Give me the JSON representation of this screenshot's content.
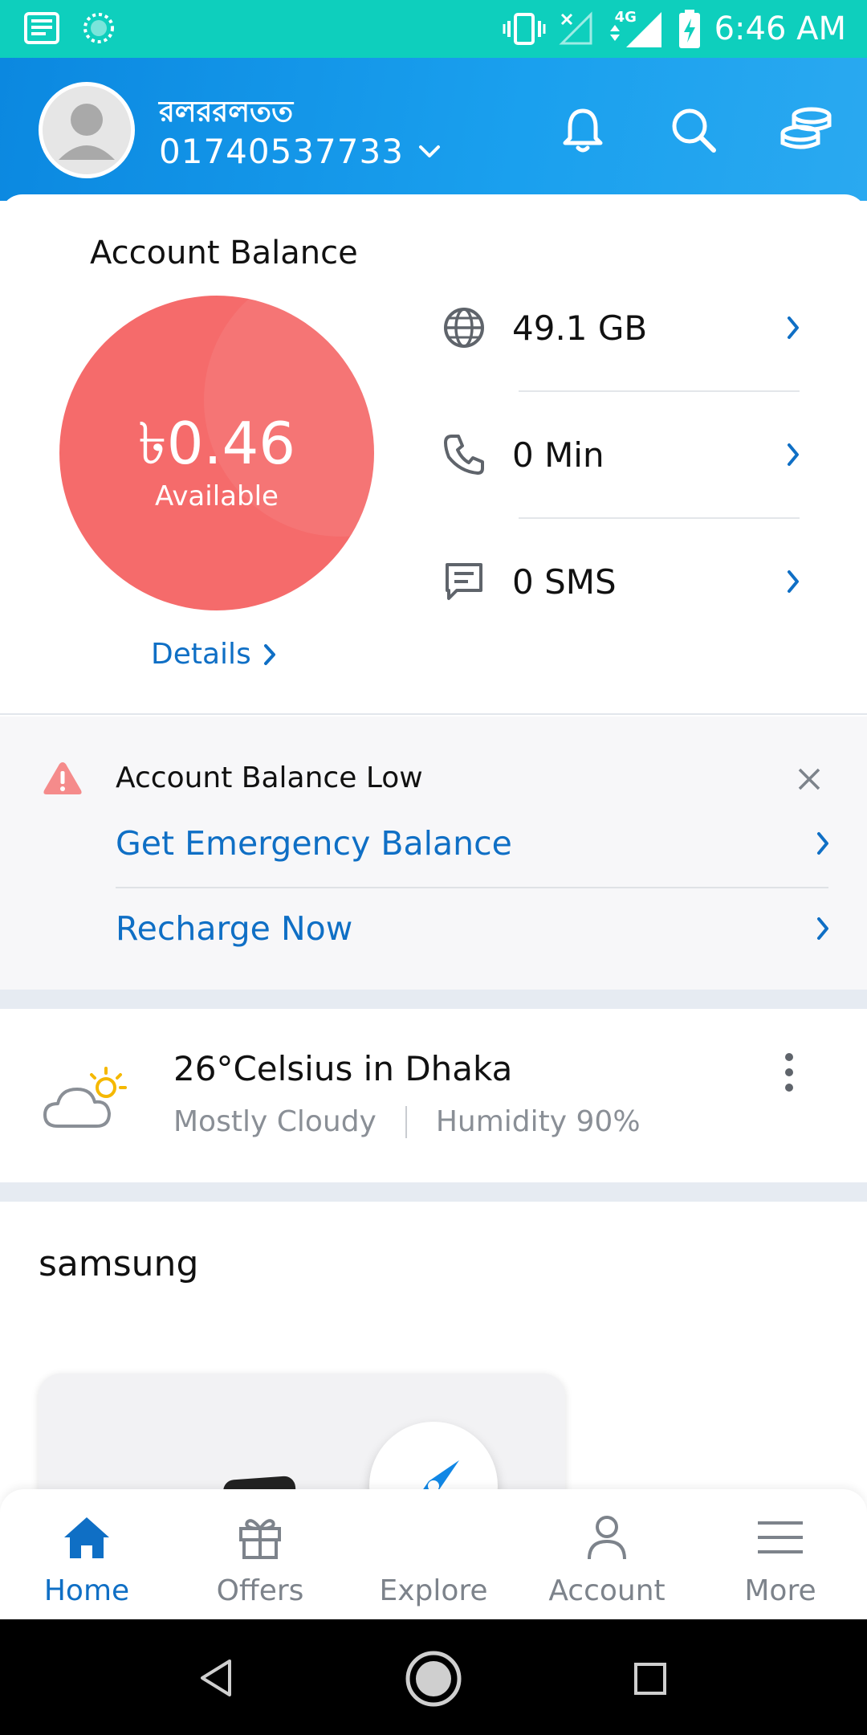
{
  "status_bar": {
    "time": "6:46 AM",
    "network": "4G"
  },
  "header": {
    "user_name": "রলররলতত",
    "phone_number": "01740537733"
  },
  "balance": {
    "title": "Account Balance",
    "amount": "৳0.46",
    "amount_label": "Available",
    "details_label": "Details",
    "circle_color": "#f56b6b"
  },
  "usage": [
    {
      "icon": "globe-icon",
      "text": "49.1 GB"
    },
    {
      "icon": "phone-icon",
      "text": "0 Min"
    },
    {
      "icon": "sms-icon",
      "text": "0 SMS"
    }
  ],
  "alert": {
    "title": "Account Balance Low",
    "links": [
      "Get Emergency Balance",
      "Recharge Now"
    ]
  },
  "weather": {
    "title": "26°Celsius in Dhaka",
    "condition": "Mostly Cloudy",
    "humidity": "Humidity 90%"
  },
  "samsung": {
    "title": "samsung"
  },
  "bottom_nav": {
    "items": [
      "Home",
      "Offers",
      "Explore",
      "Account",
      "More"
    ],
    "active": "Home"
  },
  "colors": {
    "primary": "#0f6fc5",
    "header": "#1a9aea",
    "status_bar": "#0ecfbd",
    "alert_icon": "#f58b8b"
  }
}
